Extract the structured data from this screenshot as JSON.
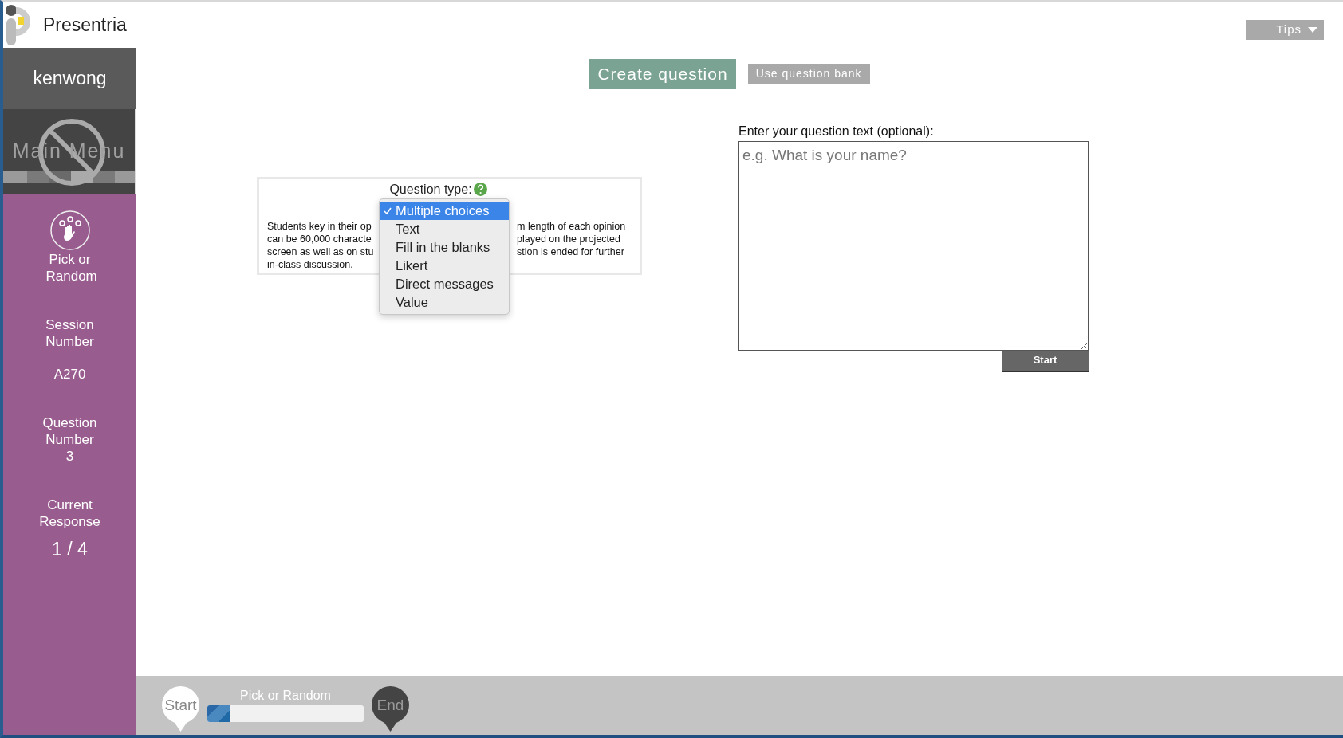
{
  "app": {
    "name": "Presentria"
  },
  "tips_button": {
    "label": "Tips"
  },
  "sidebar": {
    "user": "kenwong",
    "main_menu": {
      "label": "Main Menu",
      "disabled": true
    },
    "mode": "Pick or Random",
    "stats": [
      {
        "label": "Session Number",
        "value": "A270"
      },
      {
        "label": "Question Number",
        "value": "3"
      },
      {
        "label": "Current Response",
        "value": "1 / 4"
      }
    ]
  },
  "tabs": [
    {
      "label": "Create question",
      "selected": true
    },
    {
      "label": "Use question bank",
      "selected": false
    }
  ],
  "question_type": {
    "label": "Question type:",
    "options": [
      {
        "label": "Multiple choices",
        "selected": true
      },
      {
        "label": "Text",
        "selected": false
      },
      {
        "label": "Fill in the blanks",
        "selected": false
      },
      {
        "label": "Likert",
        "selected": false
      },
      {
        "label": "Direct messages",
        "selected": false
      },
      {
        "label": "Value",
        "selected": false
      }
    ],
    "description_left": [
      "Students key in their op",
      "can be 60,000 characte",
      "screen as well as on stu",
      "in-class discussion."
    ],
    "description_right": [
      "m length of each opinion",
      "played on the projected",
      "stion is ended for further"
    ]
  },
  "question_text": {
    "label": "Enter your question text (optional):",
    "placeholder": "e.g. What is your name?"
  },
  "start_button": {
    "label": "Start"
  },
  "progress": {
    "start": "Start",
    "label": "Pick or Random",
    "level": 0.15,
    "end": "End"
  }
}
